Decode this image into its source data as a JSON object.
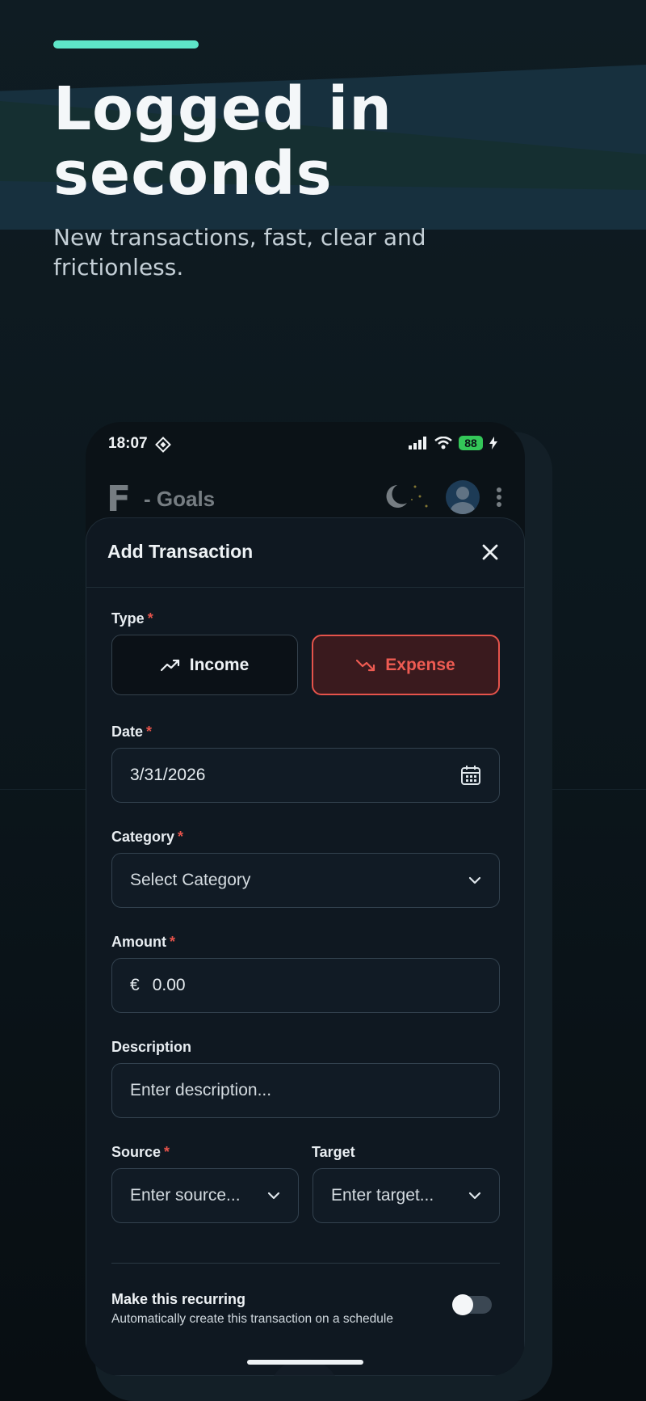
{
  "promo": {
    "headline": "Logged in seconds",
    "subheadline": "New transactions, fast, clear and frictionless."
  },
  "status_bar": {
    "time": "18:07",
    "battery": "88"
  },
  "app_bar": {
    "title": "- Goals"
  },
  "modal": {
    "title": "Add Transaction",
    "required_mark": "*",
    "type": {
      "label": "Type",
      "income_label": "Income",
      "expense_label": "Expense",
      "selected": "Expense"
    },
    "date": {
      "label": "Date",
      "value": "3/31/2026"
    },
    "category": {
      "label": "Category",
      "placeholder": "Select Category"
    },
    "amount": {
      "label": "Amount",
      "currency": "€",
      "value": "0.00"
    },
    "description": {
      "label": "Description",
      "placeholder": "Enter description..."
    },
    "source": {
      "label": "Source",
      "placeholder": "Enter source..."
    },
    "target": {
      "label": "Target",
      "placeholder": "Enter target..."
    },
    "recurring": {
      "title": "Make this recurring",
      "subtitle": "Automatically create this transaction on a schedule",
      "enabled": false
    }
  },
  "colors": {
    "accent": "#5ee6c8",
    "expense": "#e5534b",
    "battery": "#34c759"
  }
}
